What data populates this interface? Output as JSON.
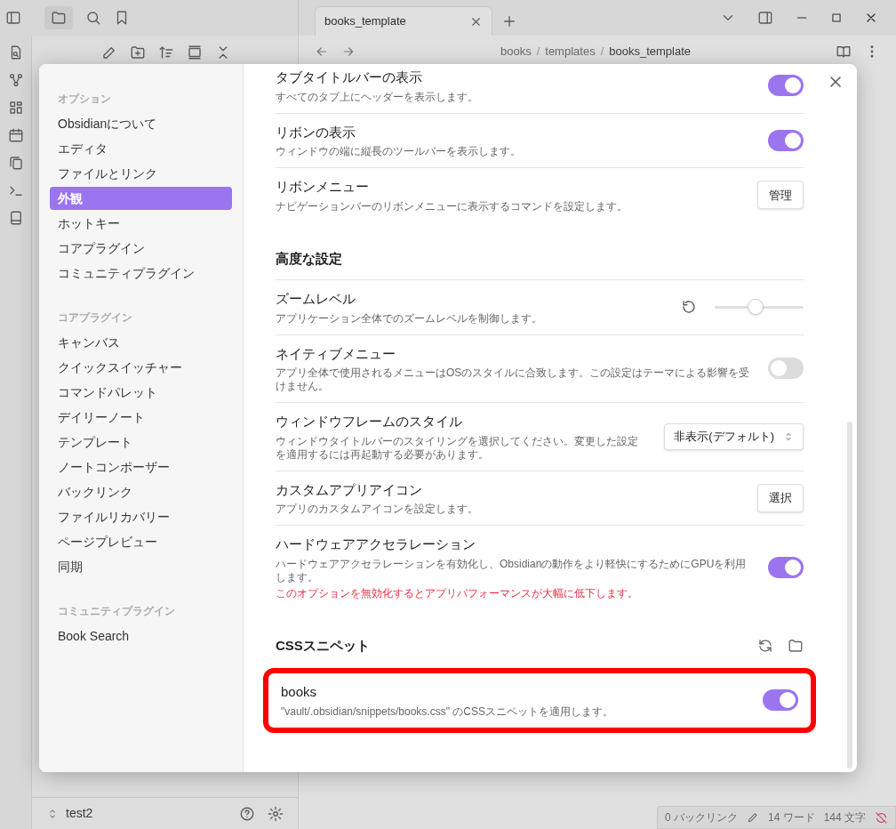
{
  "app": {
    "tab": {
      "title": "books_template"
    },
    "breadcrumbs": [
      "books",
      "templates",
      "books_template"
    ],
    "breadcrumb_separator": "/",
    "vault": {
      "name": "test2"
    },
    "status_bar": [
      "0 バックリンク",
      "14 ワード",
      "144 文字"
    ]
  },
  "settings_nav": [
    {
      "heading": "オプション",
      "items": [
        {
          "label": "Obsidianについて",
          "selected": false
        },
        {
          "label": "エディタ",
          "selected": false
        },
        {
          "label": "ファイルとリンク",
          "selected": false
        },
        {
          "label": "外観",
          "selected": true
        },
        {
          "label": "ホットキー",
          "selected": false
        },
        {
          "label": "コアプラグイン",
          "selected": false
        },
        {
          "label": "コミュニティプラグイン",
          "selected": false
        }
      ]
    },
    {
      "heading": "コアプラグイン",
      "items": [
        {
          "label": "キャンバス",
          "selected": false
        },
        {
          "label": "クイックスイッチャー",
          "selected": false
        },
        {
          "label": "コマンドパレット",
          "selected": false
        },
        {
          "label": "デイリーノート",
          "selected": false
        },
        {
          "label": "テンプレート",
          "selected": false
        },
        {
          "label": "ノートコンポーザー",
          "selected": false
        },
        {
          "label": "バックリンク",
          "selected": false
        },
        {
          "label": "ファイルリカバリー",
          "selected": false
        },
        {
          "label": "ページプレビュー",
          "selected": false
        },
        {
          "label": "同期",
          "selected": false
        }
      ]
    },
    {
      "heading": "コミュニティプラグイン",
      "items": [
        {
          "label": "Book Search",
          "selected": false
        }
      ]
    }
  ],
  "settings": [
    {
      "kind": "toggle",
      "name": "タブタイトルバーの表示",
      "description": "すべてのタブ上にヘッダーを表示します。",
      "on": true
    },
    {
      "kind": "toggle",
      "name": "リボンの表示",
      "description": "ウィンドウの端に縦長のツールバーを表示します。",
      "on": true
    },
    {
      "kind": "button",
      "name": "リボンメニュー",
      "description": "ナビゲーションバーのリボンメニューに表示するコマンドを設定します。",
      "button": "管理"
    },
    {
      "kind": "heading",
      "name": "高度な設定"
    },
    {
      "kind": "slider",
      "name": "ズームレベル",
      "description": "アプリケーション全体でのズームレベルを制御します。",
      "level": 0.45
    },
    {
      "kind": "toggle",
      "name": "ネイティブメニュー",
      "description": "アプリ全体で使用されるメニューはOSのスタイルに合致します。この設定はテーマによる影響を受けません。",
      "on": false
    },
    {
      "kind": "dropdown",
      "name": "ウィンドウフレームのスタイル",
      "description": "ウィンドウタイトルバーのスタイリングを選択してください。変更した設定を適用するには再起動する必要があります。",
      "value": "非表示(デフォルト)"
    },
    {
      "kind": "button",
      "name": "カスタムアプリアイコン",
      "description": "アプリのカスタムアイコンを設定します。",
      "button": "選択"
    },
    {
      "kind": "toggle",
      "name": "ハードウェアアクセラレーション",
      "description": "ハードウェアアクセラレーションを有効化し、Obsidianの動作をより軽快にするためにGPUを利用します。",
      "warning": "このオプションを無効化するとアプリパフォーマンスが大幅に低下します。",
      "on": true
    },
    {
      "kind": "section",
      "name": "CSSスニペット"
    },
    {
      "kind": "snippet",
      "name": "books",
      "description": "\"vault/.obsidian/snippets/books.css\" のCSSスニペットを適用します。",
      "on": true,
      "highlighted": true
    }
  ]
}
